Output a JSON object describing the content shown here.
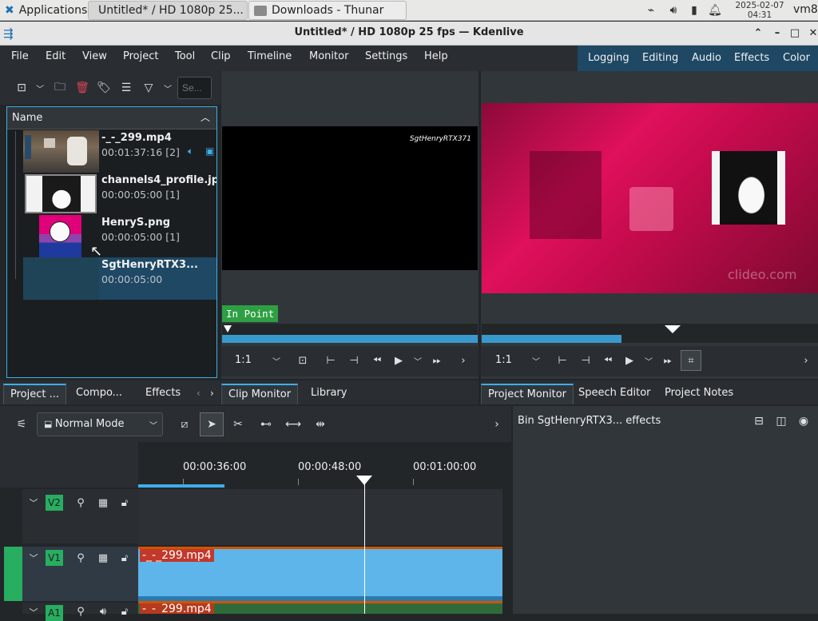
{
  "taskbar": {
    "applications_label": "Applications",
    "tasks": [
      {
        "label": "Untitled* / HD 1080p 25...",
        "active": true
      },
      {
        "label": "Downloads - Thunar",
        "active": false
      }
    ],
    "date": "2025-02-07",
    "time": "04:31",
    "user": "vm8"
  },
  "window": {
    "title": "Untitled* / HD 1080p 25 fps — Kdenlive"
  },
  "menu": {
    "items": [
      "File",
      "Edit",
      "View",
      "Project",
      "Tool",
      "Clip",
      "Timeline",
      "Monitor",
      "Settings",
      "Help"
    ]
  },
  "layouts": {
    "items": [
      "Logging",
      "Editing",
      "Audio",
      "Effects",
      "Color"
    ]
  },
  "bin": {
    "search_placeholder": "Se...",
    "column_name": "Name",
    "clips": [
      {
        "name": "-_-_299.mp4",
        "duration": "00:01:37:16 [2]"
      },
      {
        "name": "channels4_profile.jp",
        "duration": "00:00:05:00 [1]"
      },
      {
        "name": "HenryS.png",
        "duration": "00:00:05:00 [1]"
      },
      {
        "name": "SgtHenryRTX3...",
        "duration": "00:00:05:00"
      }
    ],
    "tabs": [
      "Project ...",
      "Compo...",
      "Effects"
    ]
  },
  "clip_monitor": {
    "overlay_text": "SgtHenryRTX371",
    "in_point_label": "In Point",
    "zoom": "1:1",
    "tabs": [
      "Clip Monitor",
      "Library"
    ]
  },
  "project_monitor": {
    "watermark": "clideo.com",
    "zoom": "1:1",
    "tabs": [
      "Project Monitor",
      "Speech Editor",
      "Project Notes"
    ]
  },
  "timeline": {
    "mode": "Normal Mode",
    "timecodes": [
      "00:00:36:00",
      "00:00:48:00",
      "00:01:00:00"
    ],
    "tracks": [
      {
        "name": "V2"
      },
      {
        "name": "V1",
        "clip": "-_-_299.mp4"
      },
      {
        "name": "A1",
        "clip": "-_-_299.mp4"
      }
    ]
  },
  "effects_panel": {
    "title": "Bin SgtHenryRTX3... effects"
  },
  "colors": {
    "accent": "#3daee9",
    "video_clip": "#5eb5e9",
    "audio_clip": "#b53a1e",
    "track_badge": "#27ae60",
    "in_point": "#2ea043",
    "layout_bar": "#1e4864"
  }
}
